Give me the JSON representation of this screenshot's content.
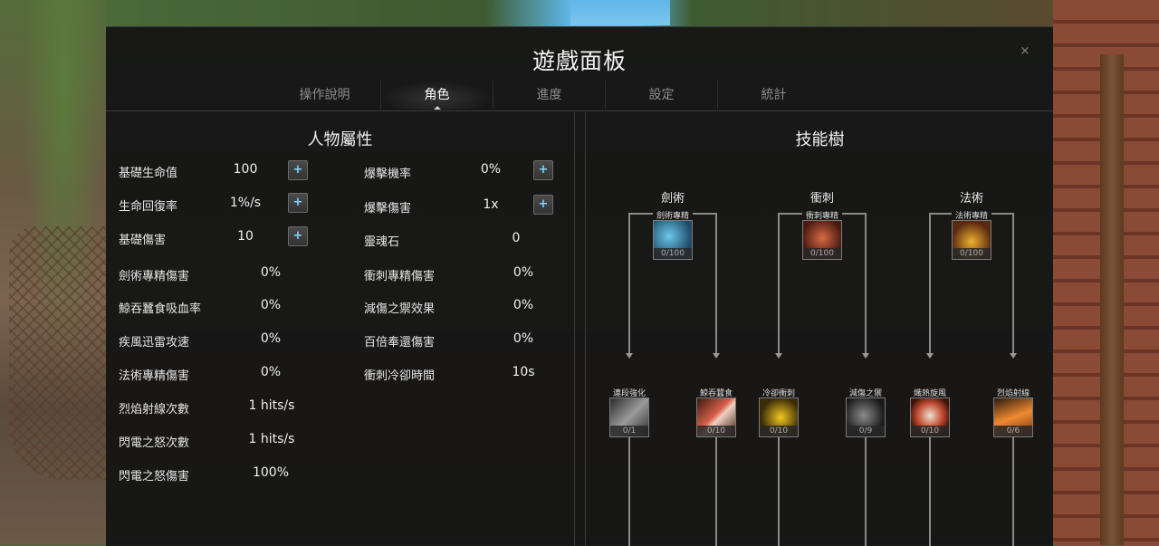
{
  "panel": {
    "title": "遊戲面板",
    "close": "×"
  },
  "tabs": [
    "操作說明",
    "角色",
    "進度",
    "設定",
    "統計"
  ],
  "active_tab": "角色",
  "attributes": {
    "title": "人物屬性",
    "left": [
      {
        "label": "基礎生命值",
        "value": "100",
        "plus": "+"
      },
      {
        "label": "生命回復率",
        "value": "1%/s",
        "plus": "+"
      },
      {
        "label": "基礎傷害",
        "value": "10",
        "plus": "+"
      },
      {
        "label": "劍術專精傷害",
        "value": "0%"
      },
      {
        "label": "鯨吞蠶食吸血率",
        "value": "0%"
      },
      {
        "label": "疾風迅雷攻速",
        "value": "0%"
      },
      {
        "label": "法術專精傷害",
        "value": "0%"
      },
      {
        "label": "烈焰射線次數",
        "value": "1 hits/s"
      },
      {
        "label": "閃電之怒次數",
        "value": "1 hits/s"
      },
      {
        "label": "閃電之怒傷害",
        "value": "100%"
      }
    ],
    "right": [
      {
        "label": "爆擊機率",
        "value": "0%",
        "plus": "+"
      },
      {
        "label": "爆擊傷害",
        "value": "1x",
        "plus": "+"
      },
      {
        "label": "靈魂石",
        "value": "0"
      },
      {
        "label": "衝刺專精傷害",
        "value": "0%"
      },
      {
        "label": "減傷之禦效果",
        "value": "0%"
      },
      {
        "label": "百倍奉還傷害",
        "value": "0%"
      },
      {
        "label": "衝刺冷卻時間",
        "value": "10s"
      }
    ]
  },
  "skills": {
    "title": "技能樹",
    "branches": [
      {
        "name": "劍術",
        "root": {
          "name": "劍術專精",
          "count": "0/100",
          "color": "#3a8ab0"
        },
        "children": [
          {
            "name": "連段強化",
            "count": "0/1",
            "color": "#8a8a8a"
          },
          {
            "name": "鯨吞蠶食",
            "count": "0/10",
            "color": "#c0543a"
          }
        ]
      },
      {
        "name": "衝刺",
        "root": {
          "name": "衝刺專精",
          "count": "0/100",
          "color": "#a0482e"
        },
        "children": [
          {
            "name": "冷卻衝刺",
            "count": "0/10",
            "color": "#d8b020"
          },
          {
            "name": "減傷之禦",
            "count": "0/9",
            "color": "#6a6a6a"
          }
        ]
      },
      {
        "name": "法術",
        "root": {
          "name": "法術專精",
          "count": "0/100",
          "color": "#c88a20"
        },
        "children": [
          {
            "name": "熾熱旋風",
            "count": "0/10",
            "color": "#c04a30"
          },
          {
            "name": "烈焰射線",
            "count": "0/6",
            "color": "#d8702a"
          }
        ]
      }
    ]
  }
}
